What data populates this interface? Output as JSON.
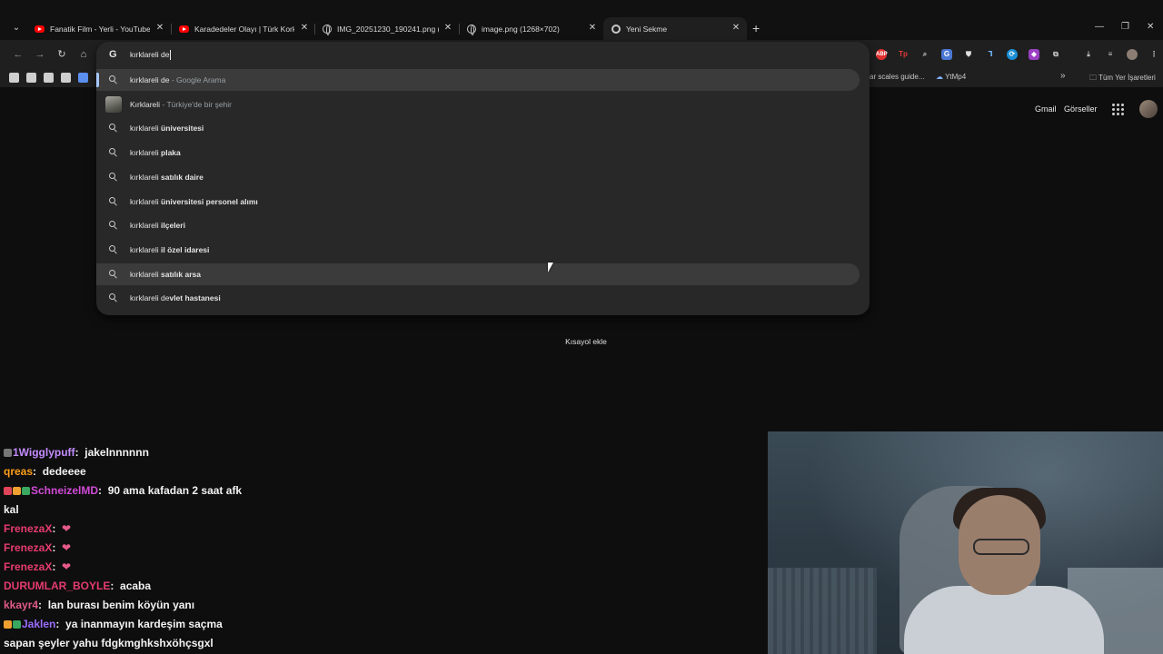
{
  "tabs": [
    {
      "title": "Fanatik Film - Yerli - YouTube",
      "icon": "youtube-icon",
      "active": false
    },
    {
      "title": "Karadedeler Olayı | Türk Korku",
      "icon": "youtube-icon",
      "active": false
    },
    {
      "title": "IMG_20251230_190241.png (10",
      "icon": "globe-icon",
      "active": false
    },
    {
      "title": "image.png (1268×702)",
      "icon": "globe-icon",
      "active": false
    },
    {
      "title": "Yeni Sekme",
      "icon": "chrome-icon",
      "active": true
    }
  ],
  "omnibox": {
    "query": "kırklareli de",
    "suggestions": [
      {
        "prefix": "kırklareli de",
        "bold": "",
        "secondary": " - Google Arama",
        "icon": "search-icon",
        "selected": true
      },
      {
        "prefix": "Kırklareli",
        "bold": "",
        "secondary": " - Türkiye'de bir şehir",
        "icon": "thumbnail",
        "selected": false
      },
      {
        "prefix": "kırklareli ",
        "bold": "üniversitesi",
        "secondary": "",
        "icon": "search-icon",
        "selected": false
      },
      {
        "prefix": "kırklareli ",
        "bold": "plaka",
        "secondary": "",
        "icon": "search-icon",
        "selected": false
      },
      {
        "prefix": "kırklareli ",
        "bold": "satılık daire",
        "secondary": "",
        "icon": "search-icon",
        "selected": false
      },
      {
        "prefix": "kırklareli ",
        "bold": "üniversitesi personel alımı",
        "secondary": "",
        "icon": "search-icon",
        "selected": false
      },
      {
        "prefix": "kırklareli ",
        "bold": "ilçeleri",
        "secondary": "",
        "icon": "search-icon",
        "selected": false
      },
      {
        "prefix": "kırklareli ",
        "bold": "il özel idaresi",
        "secondary": "",
        "icon": "search-icon",
        "selected": false
      },
      {
        "prefix": "kırklareli ",
        "bold": "satılık arsa",
        "secondary": "",
        "icon": "search-icon",
        "selected": false
      },
      {
        "prefix": "kırklareli de",
        "bold": "vlet hastanesi",
        "secondary": "",
        "icon": "search-icon",
        "selected": false
      }
    ]
  },
  "bookmarks": {
    "item_scales": "ar scales guide...",
    "item_ytmp4": "YtMp4",
    "all_bookmarks": "Tüm Yer İşaretleri"
  },
  "page": {
    "gmail": "Gmail",
    "images": "Görseller",
    "add_shortcut": "Kısayol ekle"
  },
  "chat": [
    {
      "user": "1Wigglypuff",
      "color": "#c38cff",
      "message": "jakelnnnnnn"
    },
    {
      "user": "qreas",
      "color": "#ff9f1a",
      "message": "dedeeee"
    },
    {
      "user": "SchneizelMD",
      "color": "#d14bd6",
      "message": "90 ama kafadan 2 saat afk"
    },
    {
      "user": "",
      "color": "#f2f2f2",
      "message": "kal"
    },
    {
      "user": "FrenezaX",
      "color": "#e63b6f",
      "message": "❤"
    },
    {
      "user": "FrenezaX",
      "color": "#e63b6f",
      "message": "❤"
    },
    {
      "user": "FrenezaX",
      "color": "#e63b6f",
      "message": "❤"
    },
    {
      "user": "DURUMLAR_BOYLE",
      "color": "#e63b6f",
      "message": "acaba"
    },
    {
      "user": "kkayr4",
      "color": "#e05a88",
      "message": "lan burası benim köyün yanı"
    },
    {
      "user": "Jaklen",
      "color": "#9b6cff",
      "message": "ya inanmayın kardeşim saçma"
    },
    {
      "user": "",
      "color": "#f2f2f2",
      "message": "sapan şeyler yahu fdgkmghkshxöhçsgxl"
    }
  ],
  "colors": {
    "selection_accent": "#a8c7fa",
    "dropdown_bg": "#282828",
    "toolbar_bg": "#1f1f1f"
  }
}
